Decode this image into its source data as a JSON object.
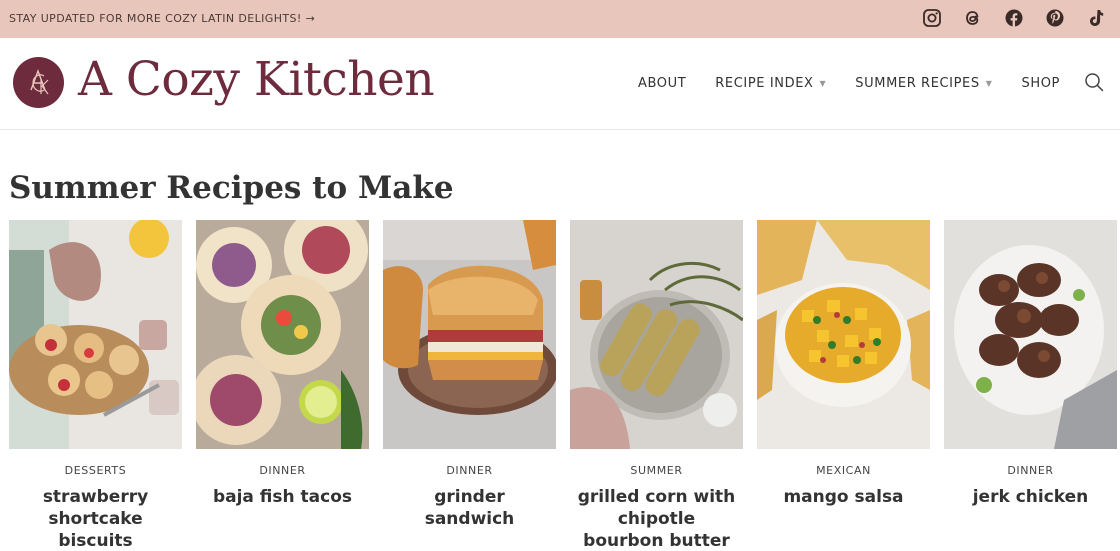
{
  "topbar": {
    "promo": "STAY UPDATED FOR MORE COZY LATIN DELIGHTS! →",
    "socials": [
      "instagram-icon",
      "threads-icon",
      "facebook-icon",
      "pinterest-icon",
      "tiktok-icon"
    ]
  },
  "header": {
    "logo_letters": "ACK",
    "title": "A Cozy Kitchen",
    "nav": [
      {
        "label": "ABOUT",
        "has_dropdown": false
      },
      {
        "label": "RECIPE INDEX",
        "has_dropdown": true
      },
      {
        "label": "SUMMER RECIPES",
        "has_dropdown": true
      },
      {
        "label": "SHOP",
        "has_dropdown": false
      }
    ]
  },
  "section": {
    "title": "Summer Recipes to Make",
    "cards": [
      {
        "category": "DESSERTS",
        "title": "strawberry shortcake biscuits"
      },
      {
        "category": "DINNER",
        "title": "baja fish tacos"
      },
      {
        "category": "DINNER",
        "title": "grinder sandwich"
      },
      {
        "category": "SUMMER",
        "title": "grilled corn with chipotle bourbon butter"
      },
      {
        "category": "MEXICAN",
        "title": "mango salsa"
      },
      {
        "category": "DINNER",
        "title": "jerk chicken"
      }
    ]
  },
  "colors": {
    "topbar_bg": "#e8c6bb",
    "brand": "#6d2b3d"
  }
}
